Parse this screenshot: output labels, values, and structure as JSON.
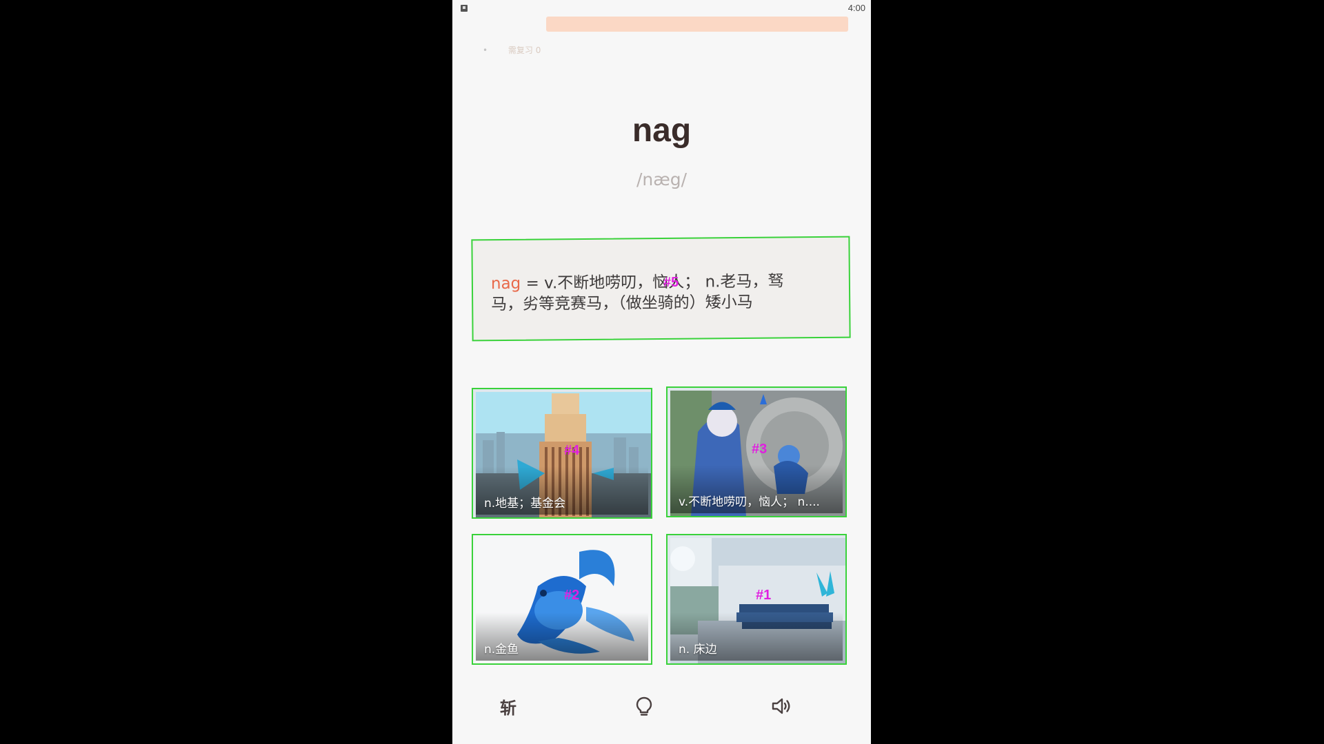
{
  "status_bar": {
    "time": "4:00"
  },
  "faded_strip_text": "需复习 0",
  "word": {
    "headword": "nag",
    "phonetic": "/næg/"
  },
  "definition": {
    "word": "nag",
    "text": " = v.不断地唠叨，恼人； n.老马，驽马，劣等竞赛马，（做坐骑的）矮小马",
    "marker": "#5"
  },
  "options": [
    {
      "marker": "#4",
      "caption": "n.地基；基金会",
      "icon": "building-illustration"
    },
    {
      "marker": "#3",
      "caption": "v.不断地唠叨，恼人； n....",
      "icon": "nagging-illustration"
    },
    {
      "marker": "#2",
      "caption": "n.金鱼",
      "icon": "goldfish-illustration"
    },
    {
      "marker": "#1",
      "caption": "n. 床边",
      "icon": "bedside-illustration"
    }
  ],
  "bottom_bar": {
    "chop_label": "斩",
    "hint_icon": "lightbulb-icon",
    "audio_icon": "speaker-icon"
  },
  "colors": {
    "accent": "#e8694a",
    "highlight_border": "#39d23a",
    "marker": "#e01fe0",
    "banner": "#fbd8c5"
  }
}
